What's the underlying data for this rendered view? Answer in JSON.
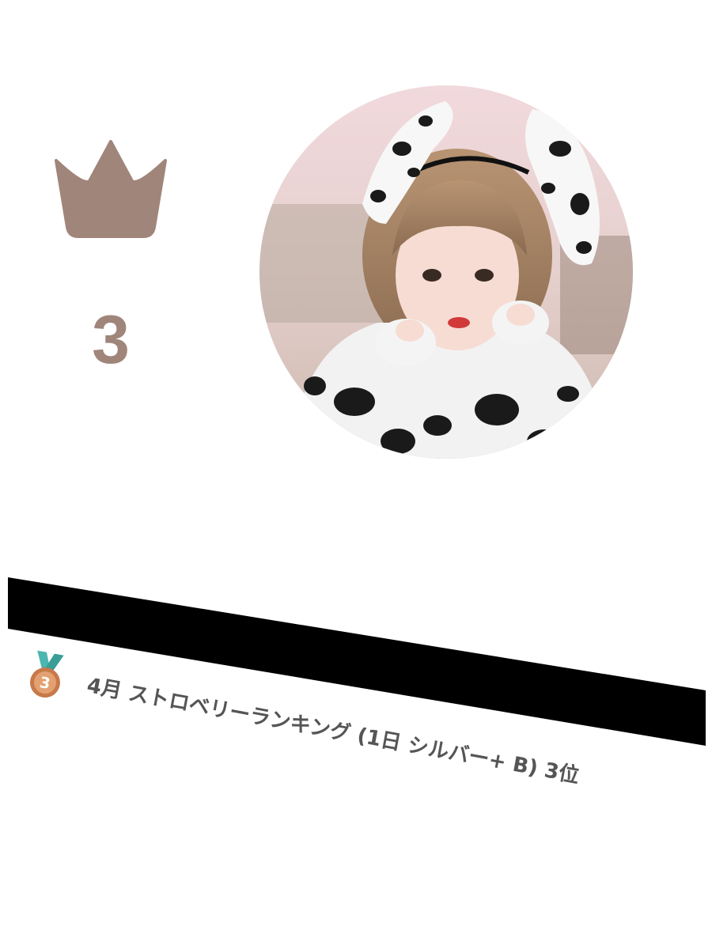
{
  "rank": {
    "icon": "crown-icon",
    "number": "3",
    "color": "#a0857a"
  },
  "avatar": {
    "description_icon": "profile-photo"
  },
  "ranking": {
    "medal_icon": "bronze-medal-3-icon",
    "medal_number": "3",
    "text": "4月 ストロベリーランキング (1日 シルバー+ B) 3位"
  },
  "colors": {
    "crown": "#a0857a",
    "text": "#555555",
    "band": "#000000",
    "medal_bronze": "#c8794a",
    "medal_ribbon": "#4cb6b0"
  }
}
